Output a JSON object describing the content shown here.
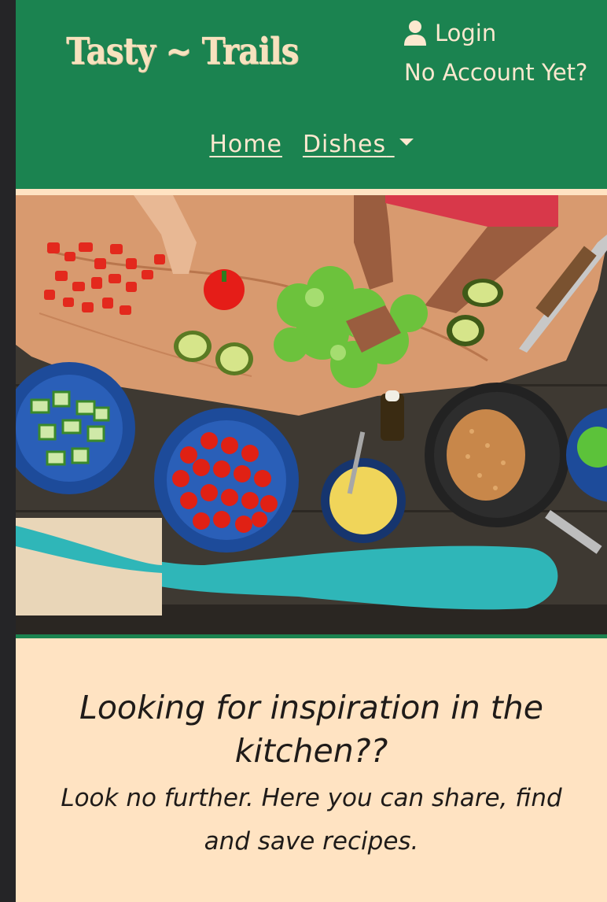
{
  "header": {
    "logo": "Tasty ~ Trails",
    "account": {
      "login_label": "Login",
      "no_account_label": "No Account Yet?",
      "user_icon": "user-icon"
    },
    "nav": {
      "home_label": "Home",
      "dishes_label": "Dishes"
    }
  },
  "hero": {
    "image": "overhead-cooking-table-photo"
  },
  "intro": {
    "heading": "Looking for inspiration in the kitchen??",
    "subheading": "Look no further. Here you can share, find and save recipes."
  },
  "colors": {
    "header_bg": "#1b8350",
    "page_bg": "#ffe3c2",
    "logo_text": "#f7e2be",
    "nav_text": "#fce8cf"
  }
}
